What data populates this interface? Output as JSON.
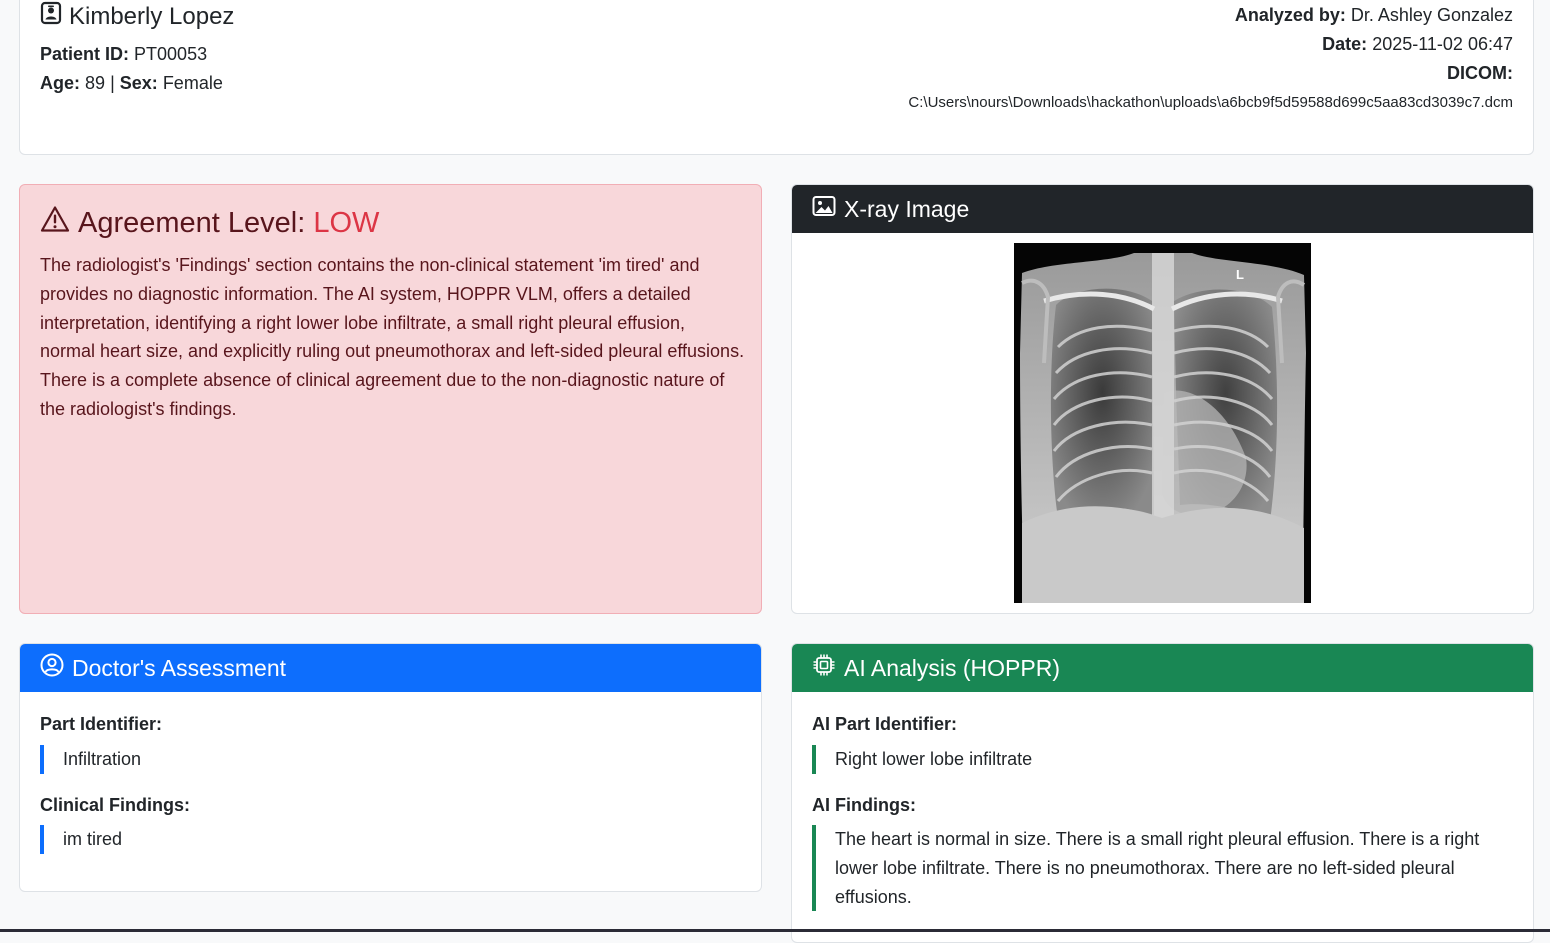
{
  "patient": {
    "name": "Kimberly Lopez",
    "patient_id_label": "Patient ID:",
    "patient_id": "PT00053",
    "age_label": "Age:",
    "age": "89",
    "separator": "|",
    "sex_label": "Sex:",
    "sex": "Female",
    "analyzed_by_label": "Analyzed by:",
    "analyzed_by": "Dr. Ashley Gonzalez",
    "date_label": "Date:",
    "date": "2025-11-02 06:47",
    "dicom_label": "DICOM:",
    "dicom_path": "C:\\Users\\nours\\Downloads\\hackathon\\uploads\\a6bcb9f5d59588d699c5aa83cd3039c7.dcm"
  },
  "agreement": {
    "title": "Agreement Level:",
    "level": "LOW",
    "text": "The radiologist's 'Findings' section contains the non-clinical statement 'im tired' and provides no diagnostic information. The AI system, HOPPR VLM, offers a detailed interpretation, identifying a right lower lobe infiltrate, a small right pleural effusion, normal heart size, and explicitly ruling out pneumothorax and left-sided pleural effusions. There is a complete absence of clinical agreement due to the non-diagnostic nature of the radiologist's findings."
  },
  "xray": {
    "title": "X-ray Image",
    "marker": "L"
  },
  "doctor": {
    "title": "Doctor's Assessment",
    "part_label": "Part Identifier:",
    "part_value": "Infiltration",
    "findings_label": "Clinical Findings:",
    "findings_value": "im tired"
  },
  "ai": {
    "title": "AI Analysis (HOPPR)",
    "part_label": "AI Part Identifier:",
    "part_value": "Right lower lobe infiltrate",
    "findings_label": "AI Findings:",
    "findings_value": "The heart is normal in size. There is a small right pleural effusion. There is a right lower lobe infiltrate. There is no pneumothorax. There are no left-sided pleural effusions."
  },
  "colors": {
    "primary": "#0d6efd",
    "success": "#198754",
    "danger": "#dc3545",
    "dark": "#212529"
  },
  "icons": {
    "patient": "person-badge-icon",
    "agreement": "warning-triangle-icon",
    "xray": "image-icon",
    "doctor": "person-circle-icon",
    "ai": "cpu-chip-icon"
  }
}
